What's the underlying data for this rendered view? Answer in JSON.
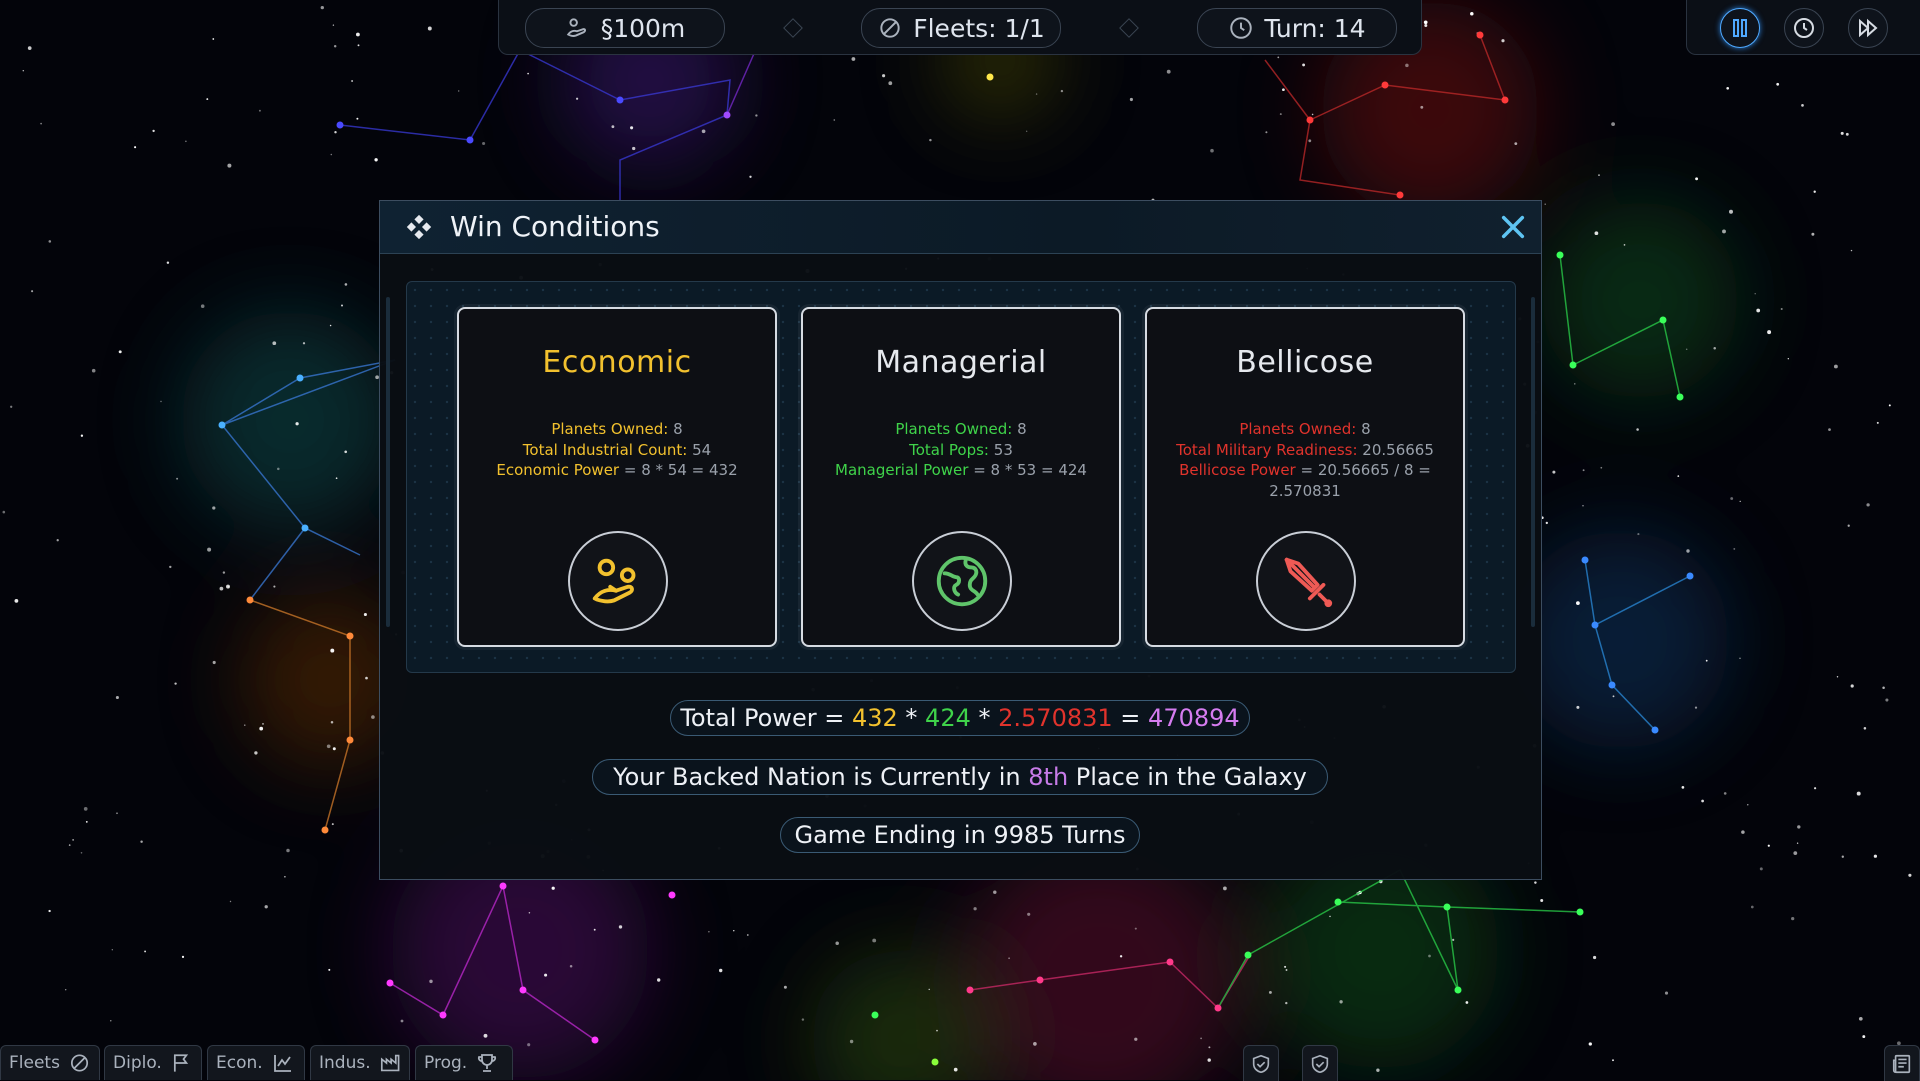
{
  "topbar": {
    "credits": "§100m",
    "fleets": "Fleets: 1/1",
    "turn": "Turn: 14"
  },
  "dialog": {
    "title": "Win Conditions",
    "cards": [
      {
        "title": "Economic",
        "color": "#f2c12e",
        "icon": "economy-icon",
        "stats": [
          {
            "label": "Planets Owned:",
            "value": "8"
          },
          {
            "label": "Total Industrial Count:",
            "value": "54"
          },
          {
            "label": "Economic Power",
            "value": "= 8 * 54 = 432"
          }
        ]
      },
      {
        "title": "Managerial",
        "color": "#e6e9ee",
        "stat_color": "#3fd34a",
        "icon": "globe-icon",
        "stats": [
          {
            "label": "Planets Owned:",
            "value": "8"
          },
          {
            "label": "Total Pops:",
            "value": "53"
          },
          {
            "label": "Managerial Power",
            "value": "= 8 * 53 = 424"
          }
        ]
      },
      {
        "title": "Bellicose",
        "color": "#e6e9ee",
        "stat_color": "#e0332c",
        "icon": "sword-icon",
        "stats": [
          {
            "label": "Planets Owned:",
            "value": "8"
          },
          {
            "label": "Total Military Readiness:",
            "value": "20.56665"
          },
          {
            "label": "Bellicose Power",
            "value": "= 20.56665 / 8 ="
          },
          {
            "label": "",
            "value": "2.570831"
          }
        ]
      }
    ],
    "total_power": {
      "prefix": "Total Power =",
      "economic": "432",
      "op1": "*",
      "managerial": "424",
      "op2": "*",
      "bellicose": "2.570831",
      "eq": "=",
      "total": "470894"
    },
    "placement": {
      "prefix": "Your Backed Nation is Currently in",
      "place": "8th",
      "suffix": "Place in the Galaxy"
    },
    "game_ending": "Game Ending in 9985 Turns"
  },
  "colors": {
    "economic": "#f2c12e",
    "managerial": "#3fd34a",
    "bellicose": "#e0332c",
    "total": "#d57cf0",
    "place": "#c77be8"
  },
  "bottom_tabs": [
    "Fleets",
    "Diplo.",
    "Econ.",
    "Indus.",
    "Prog."
  ]
}
